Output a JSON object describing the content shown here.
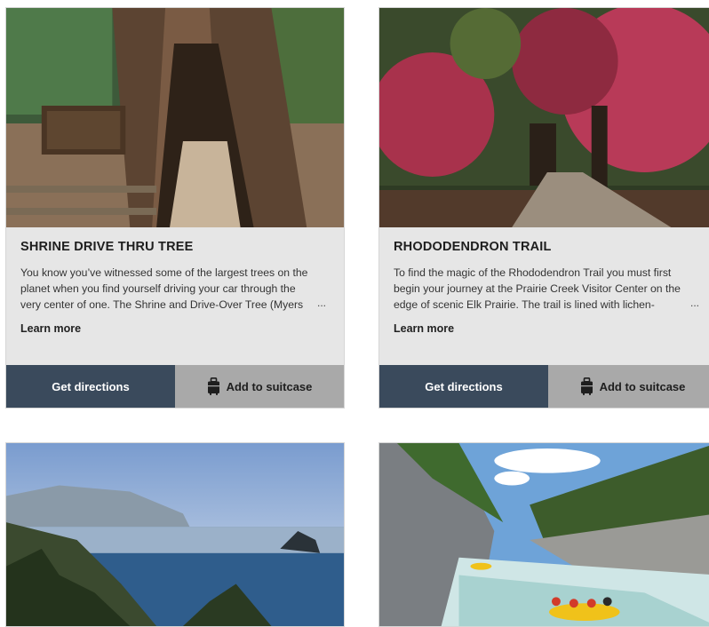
{
  "cards": [
    {
      "title": "SHRINE DRIVE THRU TREE",
      "description": "You know you’ve witnessed some of the largest trees on the planet when you find yourself driving your car through the very center of one. The Shrine and Drive-Over Tree (Myers",
      "ellipsis": "...",
      "learn_more": "Learn more",
      "directions_label": "Get directions",
      "suitcase_label": "Add to suitcase"
    },
    {
      "title": "RHODODENDRON TRAIL",
      "description": "To find the magic of the Rhododendron Trail you must first begin your journey at the Prairie Creek Visitor Center on the edge of scenic Elk Prairie. The trail is lined with lichen-",
      "ellipsis": "...",
      "learn_more": "Learn more",
      "directions_label": "Get directions",
      "suitcase_label": "Add to suitcase"
    }
  ],
  "colors": {
    "directions_button": "#3a4a5c",
    "suitcase_button": "#a9a9a9",
    "card_background": "#e6e6e6"
  },
  "icons": {
    "suitcase": "suitcase-icon"
  }
}
